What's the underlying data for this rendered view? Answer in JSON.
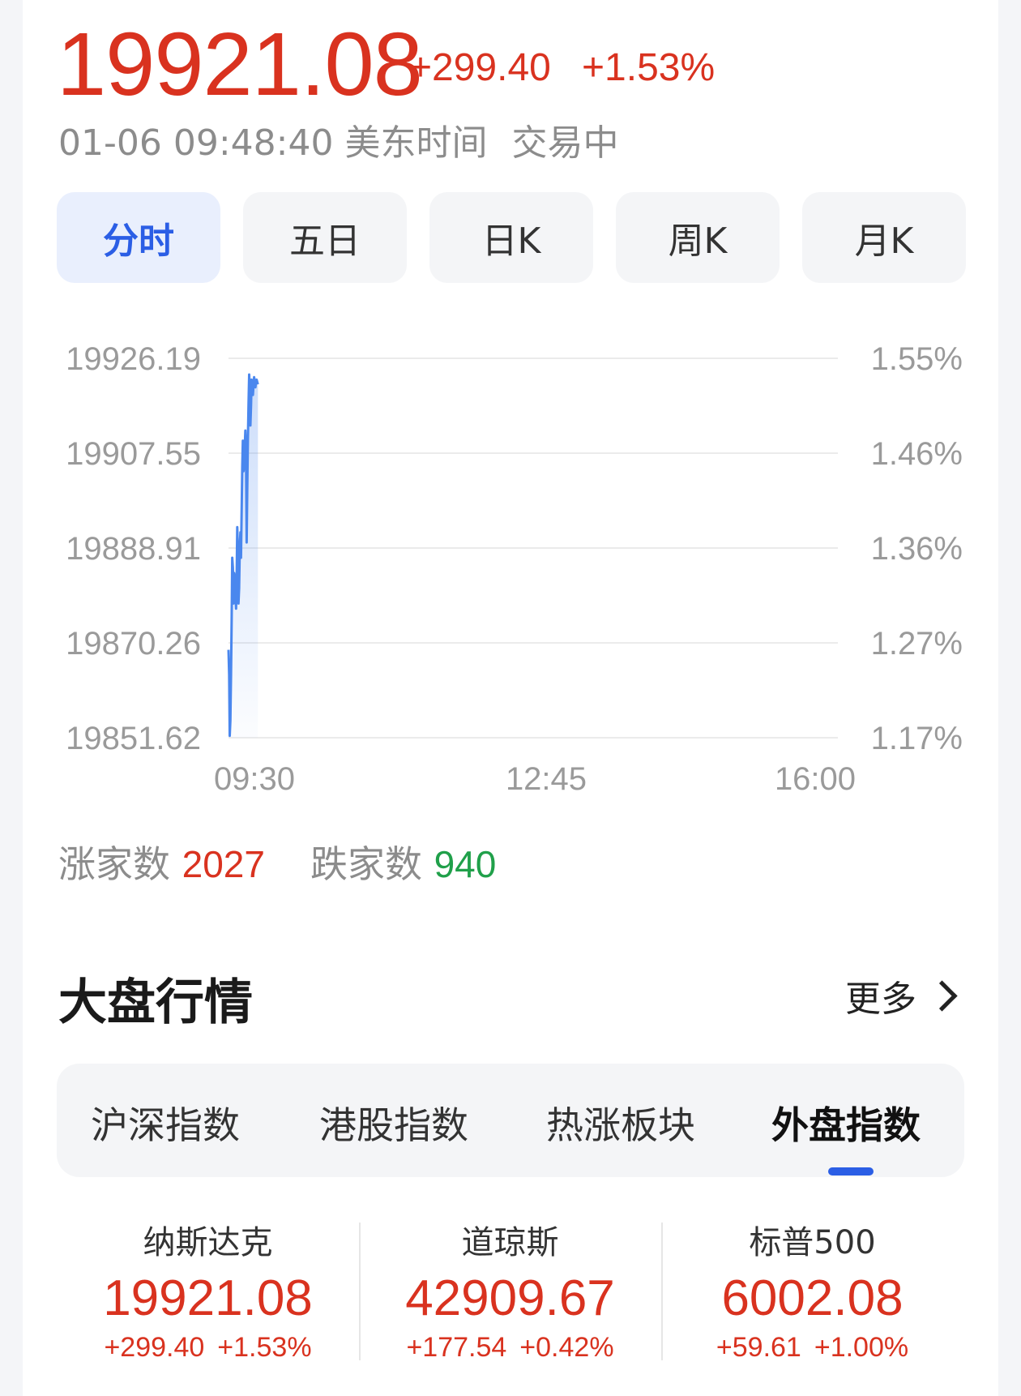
{
  "quote": {
    "price": "19921.08",
    "change": "+299.40",
    "change_pct": "+1.53%",
    "timestamp": "01-06 09:48:40 美东时间",
    "market_status": "交易中"
  },
  "period_tabs": [
    {
      "label": "分时",
      "active": true
    },
    {
      "label": "五日",
      "active": false
    },
    {
      "label": "日K",
      "active": false
    },
    {
      "label": "周K",
      "active": false
    },
    {
      "label": "月K",
      "active": false
    }
  ],
  "chart_data": {
    "type": "line",
    "y_ticks": [
      "19926.19",
      "19907.55",
      "19888.91",
      "19870.26",
      "19851.62"
    ],
    "y_pct_ticks": [
      "1.55%",
      "1.46%",
      "1.36%",
      "1.27%",
      "1.17%"
    ],
    "x_ticks": [
      "09:30",
      "12:45",
      "16:00"
    ],
    "ylim": [
      19851.62,
      19926.19
    ],
    "xlim_minutes": [
      0,
      390
    ],
    "series": [
      {
        "x": [
          0,
          0.4,
          0.8,
          1.2,
          1.6,
          2.0,
          2.4,
          2.8,
          3.2,
          3.6,
          4.0,
          4.4,
          4.8,
          5.2,
          5.6,
          6.0,
          6.4,
          6.8,
          7.2,
          7.6,
          8.0,
          8.4,
          8.8,
          9.2,
          9.6,
          10.0,
          10.4,
          10.8,
          11.2,
          11.6,
          12.0,
          12.4,
          12.8,
          13.2,
          13.6,
          14.0,
          14.4,
          14.8,
          15.2,
          15.6,
          16.0,
          16.4,
          16.8,
          17.2,
          17.6,
          18.0,
          18.4,
          18.8
        ],
        "y": [
          19868.9,
          19864.0,
          19852.0,
          19855.0,
          19864.0,
          19875.0,
          19887.0,
          19885.0,
          19878.0,
          19884.0,
          19883.0,
          19880.0,
          19877.0,
          19882.5,
          19893.0,
          19888.0,
          19878.0,
          19881.0,
          19889.0,
          19892.0,
          19887.0,
          19896.0,
          19905.0,
          19910.0,
          19904.0,
          19905.0,
          19909.0,
          19912.0,
          19908.0,
          19890.0,
          19900.0,
          19910.0,
          19917.0,
          19923.0,
          19920.0,
          19913.0,
          19917.0,
          19922.0,
          19921.08,
          19919.0,
          19921.0,
          19922.5,
          19921.5,
          19920.5,
          19921.5,
          19922.0,
          19921.5,
          19921.08
        ]
      }
    ]
  },
  "breadth": {
    "up_label": "涨家数",
    "up_count": "2027",
    "down_label": "跌家数",
    "down_count": "940"
  },
  "market_section": {
    "title": "大盘行情",
    "more_label": "更多"
  },
  "index_tabs": [
    {
      "label": "沪深指数",
      "active": false
    },
    {
      "label": "港股指数",
      "active": false
    },
    {
      "label": "热涨板块",
      "active": false
    },
    {
      "label": "外盘指数",
      "active": true
    }
  ],
  "indices": [
    {
      "name": "纳斯达克",
      "price": "19921.08",
      "change": "+299.40",
      "change_pct": "+1.53%"
    },
    {
      "name": "道琼斯",
      "price": "42909.67",
      "change": "+177.54",
      "change_pct": "+0.42%"
    },
    {
      "name": "标普500",
      "price": "6002.08",
      "change": "+59.61",
      "change_pct": "+1.00%"
    }
  ],
  "colors": {
    "up": "#d9321f",
    "down": "#20a04a",
    "accent": "#2b5ee5",
    "line": "#4a87ee"
  }
}
